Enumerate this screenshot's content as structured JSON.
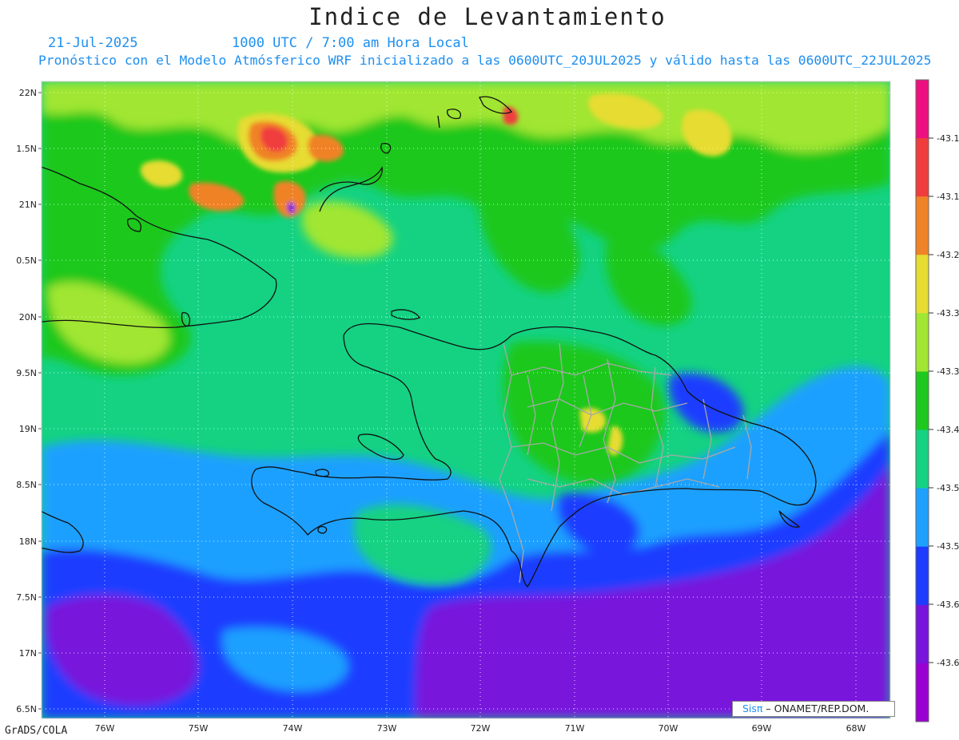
{
  "title": "Indice de Levantamiento",
  "date": "21-Jul-2025",
  "time": "1000 UTC / 7:00 am Hora Local",
  "description": "Pronóstico con el Modelo Atmósferico WRF inicializado a las 0600UTC_20JUL2025 y válido hasta las  0600UTC_22JUL2025",
  "credit": {
    "brand": "Sisπ",
    "text": " – ONAMET/REP.DOM."
  },
  "software": "GrADS/COLA",
  "lat_labels": [
    "22N",
    "1.5N",
    "21N",
    "0.5N",
    "20N",
    "9.5N",
    "19N",
    "8.5N",
    "18N",
    "7.5N",
    "17N",
    "6.5N"
  ],
  "lon_labels": [
    "76W",
    "75W",
    "74W",
    "73W",
    "72W",
    "71W",
    "70W",
    "69W",
    "68W"
  ],
  "colorbar": {
    "labels": [
      "-43.1",
      "-43.1",
      "-43.2",
      "-43.3",
      "-43.3",
      "-43.4",
      "-43.5",
      "-43.5",
      "-43.6",
      "-43.6"
    ],
    "colors": [
      "#ee1080",
      "#f03c3c",
      "#f08228",
      "#e6dc32",
      "#a0e632",
      "#1ec81e",
      "#14d282",
      "#1ea0ff",
      "#1e3cff",
      "#7814dc",
      "#9b00d2"
    ]
  },
  "colors": {
    "land_border": "#111111",
    "province_border": "#a8a8a8",
    "grid": "#ffffff"
  }
}
